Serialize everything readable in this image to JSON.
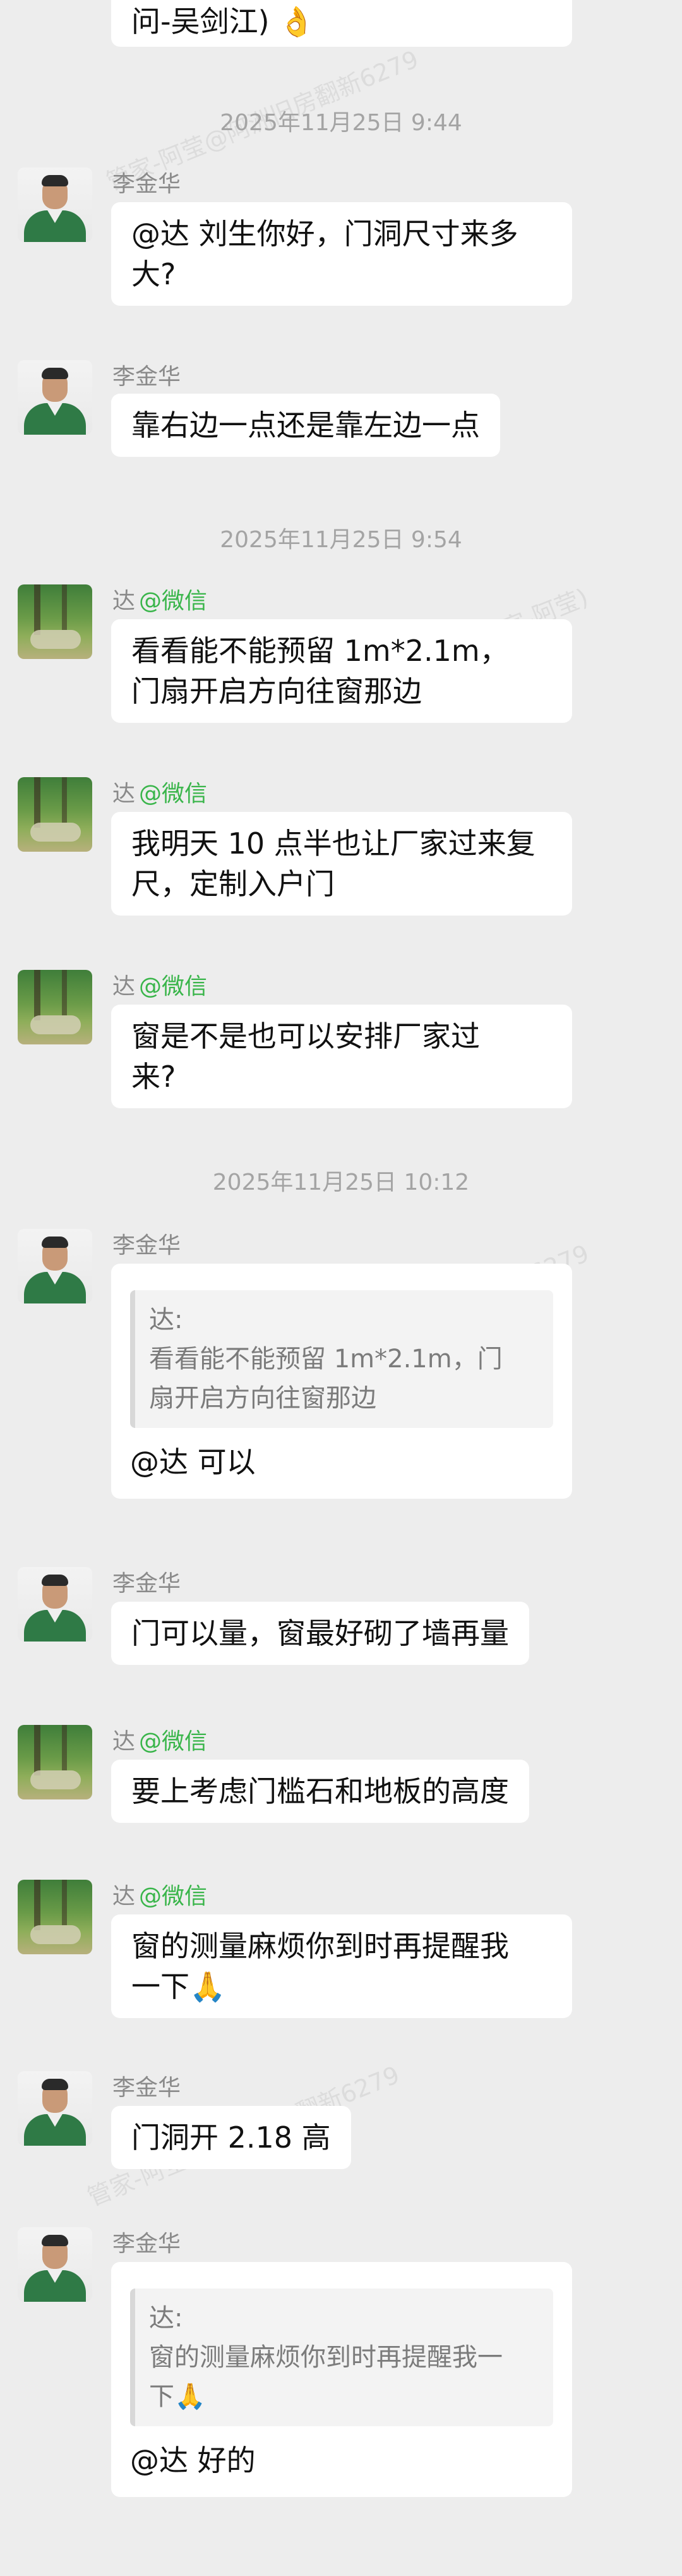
{
  "top_partial": {
    "text": "问-吴剑江) 👌"
  },
  "timestamps": [
    {
      "text": "2025年11月25日  9:44"
    },
    {
      "text": "2025年11月25日  9:54"
    },
    {
      "text": "2025年11月25日  10:12"
    }
  ],
  "watermark_texts": [
    "管家-阿莹@阿洲旧房翻新6279",
    "管家-阿莹(管家-阿莹)",
    "管家-阿莹@阿洲旧房翻新6279"
  ],
  "messages": [
    {
      "sender": "李金华",
      "tag": "",
      "text": "@达 刘生你好，门洞尺寸来多\n大?"
    },
    {
      "sender": "李金华",
      "tag": "",
      "text": "靠右边一点还是靠左边一点"
    },
    {
      "sender": "达",
      "tag": "@微信",
      "text": "看看能不能预留 1m*2.1m，\n门扇开启方向往窗那边"
    },
    {
      "sender": "达",
      "tag": "@微信",
      "text": "我明天 10 点半也让厂家过来复\n尺，定制入户门"
    },
    {
      "sender": "达",
      "tag": "@微信",
      "text": "窗是不是也可以安排厂家过\n来?"
    },
    {
      "sender": "李金华",
      "tag": "",
      "quote_from": "达:",
      "quote_text": "看看能不能预留 1m*2.1m，门\n扇开启方向往窗那边",
      "text": "@达 可以"
    },
    {
      "sender": "李金华",
      "tag": "",
      "text": "门可以量，窗最好砌了墙再量"
    },
    {
      "sender": "达",
      "tag": "@微信",
      "text": "要上考虑门槛石和地板的高度"
    },
    {
      "sender": "达",
      "tag": "@微信",
      "text": "窗的测量麻烦你到时再提醒我\n一下🙏"
    },
    {
      "sender": "李金华",
      "tag": "",
      "text": "门洞开 2.18 高"
    },
    {
      "sender": "李金华",
      "tag": "",
      "quote_from": "达:",
      "quote_text": "窗的测量麻烦你到时再提醒我一\n下🙏",
      "text": "@达 好的"
    }
  ],
  "colors": {
    "background": "#ededed",
    "bubble": "#ffffff",
    "wechat_tag": "#39b54a",
    "timestamp": "#a4a4a4"
  },
  "icons": {
    "李金华": "person-avatar-icon",
    "达": "forest-avatar-icon"
  }
}
